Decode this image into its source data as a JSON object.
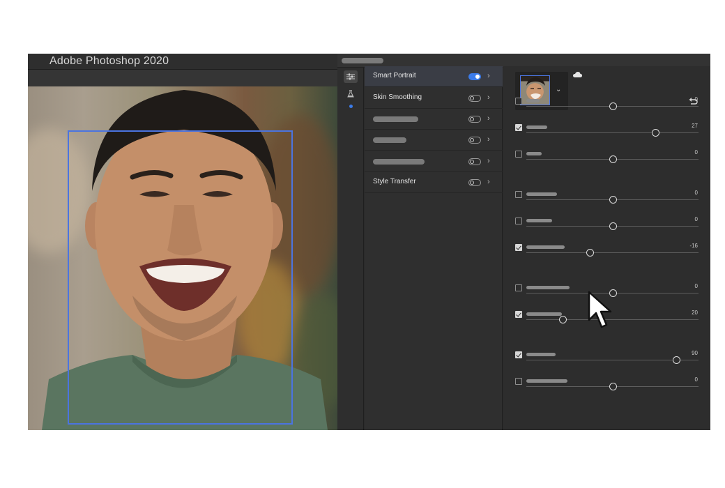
{
  "window": {
    "title": "Adobe Photoshop 2020"
  },
  "colors": {
    "accent": "#3a7bea",
    "selection": "#4b74e0",
    "panel": "#2d2d2d"
  },
  "canvas": {
    "face_detection_box": true
  },
  "toolbar": {
    "icons": [
      "sliders-icon",
      "beaker-icon"
    ]
  },
  "filters": [
    {
      "label": "Smart Portrait",
      "enabled": true
    },
    {
      "label": "Skin Smoothing",
      "enabled": false
    },
    {
      "label": "",
      "enabled": false
    },
    {
      "label": "",
      "enabled": false
    },
    {
      "label": "",
      "enabled": false
    },
    {
      "label": "Style Transfer",
      "enabled": false
    }
  ],
  "adjustments": [
    {
      "checked": false,
      "value": "0",
      "level": 0.5
    },
    {
      "checked": true,
      "value": "27",
      "level": 0.75
    },
    {
      "checked": false,
      "value": "0",
      "level": 0.5
    },
    {
      "checked": false,
      "value": "0",
      "level": 0.5
    },
    {
      "checked": false,
      "value": "0",
      "level": 0.5
    },
    {
      "checked": true,
      "value": "-16",
      "level": 0.37
    },
    {
      "checked": false,
      "value": "0",
      "level": 0.5
    },
    {
      "checked": true,
      "value": "20",
      "level": 0.21
    },
    {
      "checked": true,
      "value": "90",
      "level": 0.87
    },
    {
      "checked": false,
      "value": "0",
      "level": 0.5
    }
  ]
}
